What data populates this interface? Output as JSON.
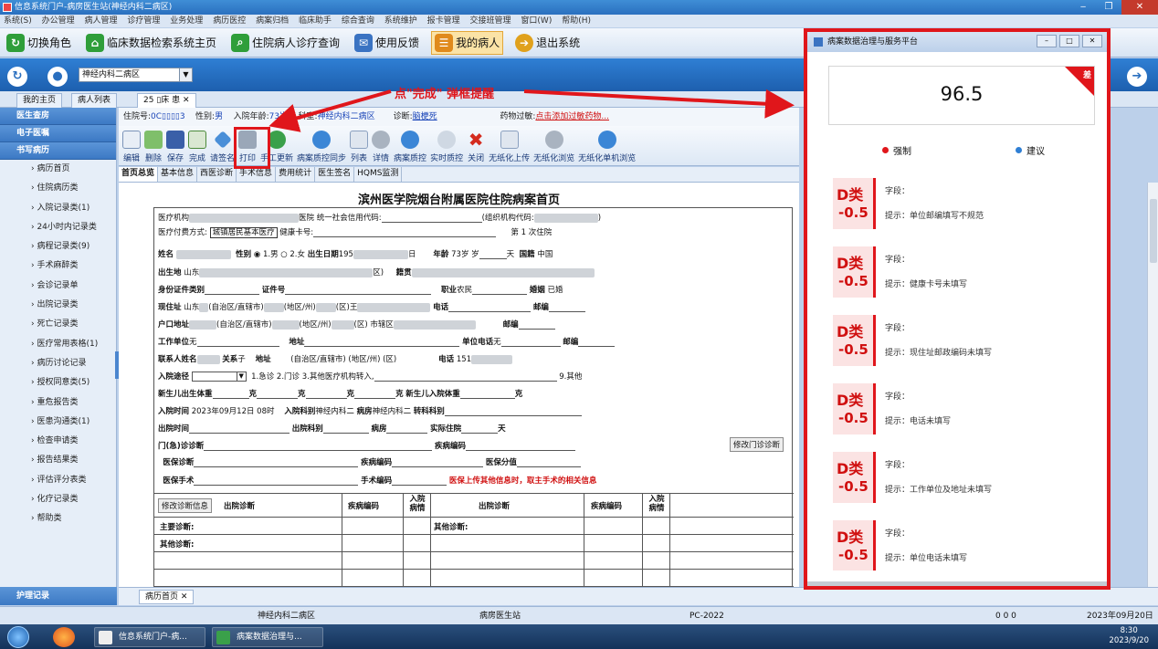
{
  "window": {
    "title": "信息系统门户-病房医生站(神经内科二病区)"
  },
  "menu": [
    "系统(S)",
    "办公管理",
    "病人管理",
    "诊疗管理",
    "业务处理",
    "病历医控",
    "病案归档",
    "临床助手",
    "综合查询",
    "系统维护",
    "报卡管理",
    "交接班管理",
    "窗口(W)",
    "帮助(H)"
  ],
  "toolbar1": [
    {
      "label": "切换角色",
      "icon": "switch-role-icon",
      "color": "#2f9e3a"
    },
    {
      "label": "临床数据检索系统主页",
      "icon": "home-icon",
      "color": "#2f9e3a"
    },
    {
      "label": "住院病人诊疗查询",
      "icon": "search-icon",
      "color": "#2f9e3a"
    },
    {
      "label": "使用反馈",
      "icon": "feedback-icon",
      "color": "#3a73c2"
    },
    {
      "label": "我的病人",
      "icon": "patient-list-icon",
      "color": "#e08a1c"
    },
    {
      "label": "退出系统",
      "icon": "exit-icon",
      "color": "#e0a11c"
    }
  ],
  "nav": {
    "ward": "神经内科二病区"
  },
  "tabs": [
    {
      "label": "我的主页"
    },
    {
      "label": "病人列表"
    },
    {
      "label": "25 ▯床 患"
    },
    {
      "label": "✕"
    }
  ],
  "sidebar": {
    "sections": [
      "医生查房",
      "电子医嘱",
      "书写病历"
    ],
    "items": [
      "病历首页",
      "住院病历类",
      "入院记录类(1)",
      "24小时内记录类",
      "病程记录类(9)",
      "手术麻醉类",
      "会诊记录单",
      "出院记录类",
      "死亡记录类",
      "医疗常用表格(1)",
      "病历讨论记录",
      "授权同意类(5)",
      "重危报告类",
      "医患沟通类(1)",
      "检查申请类",
      "报告结果类",
      "评估评分表类",
      "化疗记录类",
      "帮助类"
    ],
    "bottom": "护理记录"
  },
  "patient_info": {
    "inpatient_label": "住院号:",
    "inpatient_no": "0C▯▯▯▯3",
    "gender_label": "性别:",
    "gender": "男",
    "age_label": "入院年龄:",
    "age": "73岁",
    "ward_label": "科室:",
    "ward": "神经内科二病区",
    "diag_label": "诊断:",
    "diag": "脑梗死",
    "allergy_label": "药物过敏:",
    "allergy": "点击添加过敏药物..."
  },
  "toolbar2": [
    "编辑",
    "删除",
    "保存",
    "完成",
    "请签名",
    "打印",
    "手工更新",
    "病案质控同步",
    "列表",
    "详情",
    "病案质控",
    "实时质控",
    "关闭",
    "无纸化上传",
    "无纸化浏览",
    "无纸化单机浏览"
  ],
  "subtabs": [
    "首页总览",
    "基本信息",
    "西医诊断",
    "手术信息",
    "费用统计",
    "医生签名",
    "HQMS监测"
  ],
  "doc": {
    "title": "滨州医学院烟台附属医院住院病案首页",
    "org": "医疗机构",
    "hospital": "医院",
    "credit": "统一社会信用代码:",
    "orgcode": "(组织机构代码:",
    "paytype_label": "医疗付费方式:",
    "paytype": "城镇居民基本医疗",
    "healthcard": "健康卡号:",
    "admit_count": "第  1  次住院",
    "name": "姓名",
    "sex": "性别",
    "sex_opts": "◉ 1.男  ○ 2.女",
    "dob": "出生日期",
    "dob_val": "195",
    "day": "日",
    "age": "年龄",
    "age_val": "73岁",
    "sui": "岁",
    "tian": "天",
    "nation": "国籍",
    "nation_val": "中国",
    "birthplace": "出生地",
    "birthplace_val": "山东",
    "qu": "区)",
    "native": "籍贯",
    "idtype": "身份证件类别",
    "idno": "证件号",
    "job": "职业",
    "job_val": "农民",
    "marital": "婚姻",
    "marital_val": "已婚",
    "addr": "现住址",
    "addr_val": "山东",
    "region1": "(自治区/直辖市)",
    "region2": "(地区/州)",
    "region3": "(区)",
    "region3_val": "王",
    "phone": "电话",
    "postcode": "邮编",
    "hukou": "户口地址",
    "hukou_region1": "(自治区/直辖市)",
    "hukou_region2": "(地区/州)",
    "hukou_region3": "(区)",
    "hukou_street": "市辖区",
    "workunit": "工作单位",
    "workunit_val": "无",
    "workaddr": "地址",
    "unitphone": "单位电话",
    "unitphone_val": "无",
    "contact": "联系人姓名",
    "relation": "关系",
    "relation_val": "子",
    "contact_addr": "地址",
    "contact_region": "(自治区/直辖市)      (地区/州)        (区)",
    "contact_phone": "电话",
    "contact_phone_val": "151",
    "route": "入院途径",
    "route_opts": "1.急诊  2.门诊  3.其他医疗机构转入,",
    "route_other": "9.其他",
    "newborn_w": "新生儿出生体重",
    "ke": "克",
    "newborn_adm": "新生儿入院体重",
    "adm_time": "入院时间",
    "adm_time_val": "2023年09月12日 08时",
    "adm_dept": "入院科别",
    "adm_dept_val": "神经内科二",
    "ward": "病房",
    "ward_val": "神经内科二",
    "transfer": "转科科别",
    "dis_time": "出院时间",
    "dis_dept": "出院科别",
    "dis_ward": "病房",
    "stay": "实际住院",
    "stay_unit": "天",
    "op_diag": "门(急)诊诊断",
    "disease_code": "疾病编码",
    "edit_op_btn": "修改门诊诊断",
    "ins_diag": "医保诊断",
    "ins_code": "疾病编码",
    "ins_score": "医保分值",
    "ins_surgery": "医保手术",
    "surgery_code": "手术编码",
    "red_note": "医保上传其他信息时，取主手术的相关信息",
    "edit_diag_btn": "修改诊断信息",
    "dis_diag": "出院诊断",
    "code_col": "疾病编码",
    "adm_cond": "入院病情",
    "main_diag": "主要诊断:",
    "other_diag": "其他诊断:",
    "other_diag2": "其他诊断:"
  },
  "bottom_tab": "病历首页",
  "statusbar": {
    "ward": "神经内科二病区",
    "station": "病房医生站",
    "pc": "PC-2022",
    "counts": "0   0   0",
    "date": "2023年09月20日"
  },
  "taskbar": {
    "apps": [
      "信息系统门户-病...",
      "病案数据治理与..."
    ],
    "time": "8:30",
    "date": "2023/9/20"
  },
  "annotation": "点\"完成\"  弹框提醒",
  "dialog": {
    "title": "病案数据治理与服务平台",
    "score": "96.5",
    "corner": "差",
    "legend_force": "强制",
    "legend_suggest": "建议",
    "force_color": "#e0161b",
    "suggest_color": "#2f7fd4",
    "issues": [
      {
        "cls": "D类",
        "score": "-0.5",
        "field": "字段：",
        "tip": "提示：单位邮编填写不规范"
      },
      {
        "cls": "D类",
        "score": "-0.5",
        "field": "字段：",
        "tip": "提示：健康卡号未填写"
      },
      {
        "cls": "D类",
        "score": "-0.5",
        "field": "字段：",
        "tip": "提示：现住址邮政编码未填写"
      },
      {
        "cls": "D类",
        "score": "-0.5",
        "field": "字段：",
        "tip": "提示：电话未填写"
      },
      {
        "cls": "D类",
        "score": "-0.5",
        "field": "字段：",
        "tip": "提示：工作单位及地址未填写"
      },
      {
        "cls": "D类",
        "score": "-0.5",
        "field": "字段：",
        "tip": "提示：单位电话未填写"
      }
    ]
  }
}
